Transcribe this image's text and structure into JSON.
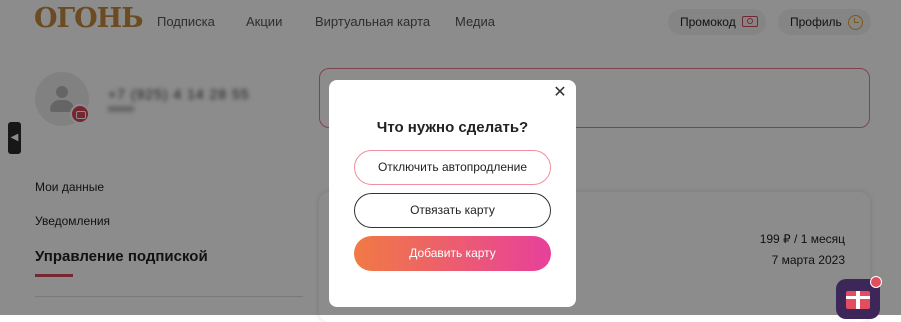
{
  "header": {
    "logo": "ОГОНЬ",
    "nav": [
      "Подписка",
      "Акции",
      "Виртуальная карта",
      "Медиа"
    ],
    "promo_label": "Промокод",
    "profile_label": "Профиль"
  },
  "profile": {
    "phone": "+7 (925) 4 14 28 55"
  },
  "menu": {
    "items": [
      "Мои данные",
      "Уведомления"
    ],
    "active": "Управление подпиской"
  },
  "subscription": {
    "price": "199 ₽ / 1 месяц",
    "date": "7 марта 2023"
  },
  "modal": {
    "title": "Что нужно сделать?",
    "close_symbol": "✕",
    "buttons": {
      "disable_autorenew": "Отключить автопродление",
      "unlink_card": "Отвязать карту",
      "add_card": "Добавить карту"
    }
  },
  "colors": {
    "accent": "#d6455a",
    "logo": "#c48a3f",
    "gradient_start": "#f07a44",
    "gradient_end": "#e8409b"
  },
  "icons": [
    "promo-icon",
    "clock-icon",
    "camera-icon",
    "user-icon",
    "gift-icon",
    "close-icon",
    "arrow-left-icon"
  ]
}
